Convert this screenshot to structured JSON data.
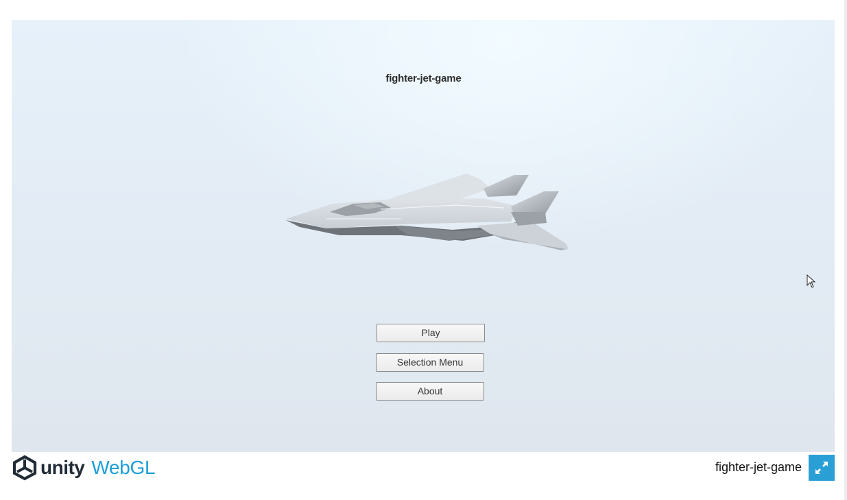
{
  "game": {
    "title": "fighter-jet-game",
    "menu": {
      "play_label": "Play",
      "selection_label": "Selection Menu",
      "about_label": "About"
    }
  },
  "footer": {
    "logo_unity": "unity",
    "logo_webgl": "WebGL",
    "title": "fighter-jet-game",
    "fullscreen_icon": "fullscreen-icon"
  },
  "colors": {
    "unity_dark": "#222c37",
    "webgl_blue": "#1c9dd8",
    "fullscreen_bg": "#2a9fd6",
    "sky_top": "#e6f1fa",
    "sky_bottom": "#dfe6ee"
  }
}
